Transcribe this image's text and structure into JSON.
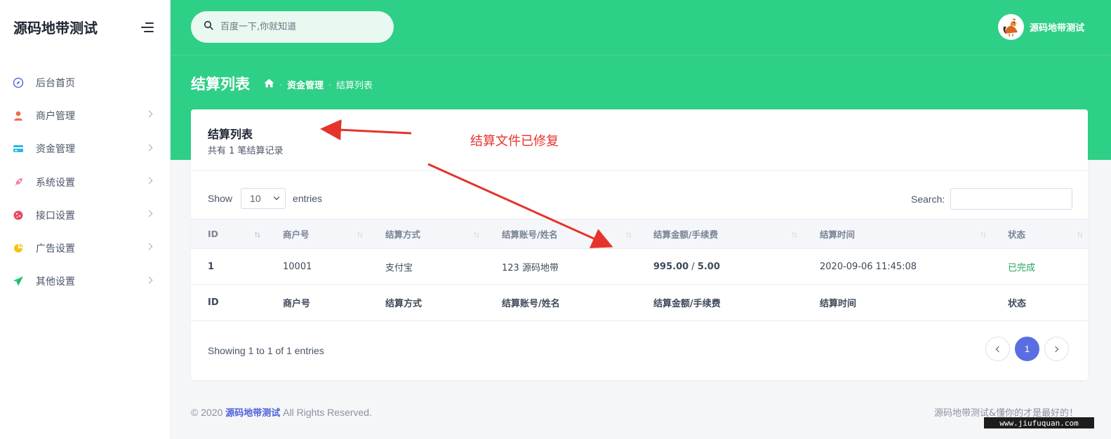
{
  "sidebar": {
    "brand": "源码地带测试",
    "menu_toggle": "menu-icon",
    "items": [
      {
        "label": "后台首页",
        "icon": "compass-icon",
        "color": "#5b6ee1",
        "has_children": false
      },
      {
        "label": "商户管理",
        "icon": "user-icon",
        "color": "#ee6a46",
        "has_children": true
      },
      {
        "label": "资金管理",
        "icon": "card-icon",
        "color": "#27b9e6",
        "has_children": true
      },
      {
        "label": "系统设置",
        "icon": "rocket-icon",
        "color": "#f083a6",
        "has_children": true
      },
      {
        "label": "接口设置",
        "icon": "cookie-icon",
        "color": "#e74d62",
        "has_children": true
      },
      {
        "label": "广告设置",
        "icon": "pie-icon",
        "color": "#f4c21a",
        "has_children": true
      },
      {
        "label": "其他设置",
        "icon": "send-icon",
        "color": "#2ecf86",
        "has_children": true
      }
    ]
  },
  "header": {
    "search_placeholder": "百度一下,你就知道",
    "user_name": "源码地带测试",
    "accent": "#2ecf86"
  },
  "page": {
    "title": "结算列表",
    "breadcrumb": [
      "资金管理",
      "结算列表"
    ]
  },
  "card": {
    "title": "结算列表",
    "subtitle": "共有 1 笔结算记录",
    "annotation": "结算文件已修复"
  },
  "table_controls": {
    "show_label": "Show",
    "length_value": "10",
    "entries_label": "entries",
    "search_label": "Search:"
  },
  "table": {
    "columns": [
      "ID",
      "商户号",
      "结算方式",
      "结算账号/姓名",
      "结算金额/手续费",
      "结算时间",
      "状态"
    ],
    "rows": [
      {
        "id": "1",
        "merchant": "10001",
        "method": "支付宝",
        "account": "123 源码地带",
        "amount": "995.00",
        "amount_sep": " / ",
        "fee": "5.00",
        "time": "2020-09-06 11:45:08",
        "status": "已完成"
      }
    ]
  },
  "pagination": {
    "info": "Showing 1 to 1 of 1 entries",
    "current_page": "1"
  },
  "footer": {
    "copyright_prefix": "© 2020",
    "brand_link": "源码地带测试",
    "copyright_suffix": "All Rights Reserved.",
    "right_text": "源码地带测试&懂你的才是最好的！"
  },
  "watermark": "www.jiufuquan.com"
}
